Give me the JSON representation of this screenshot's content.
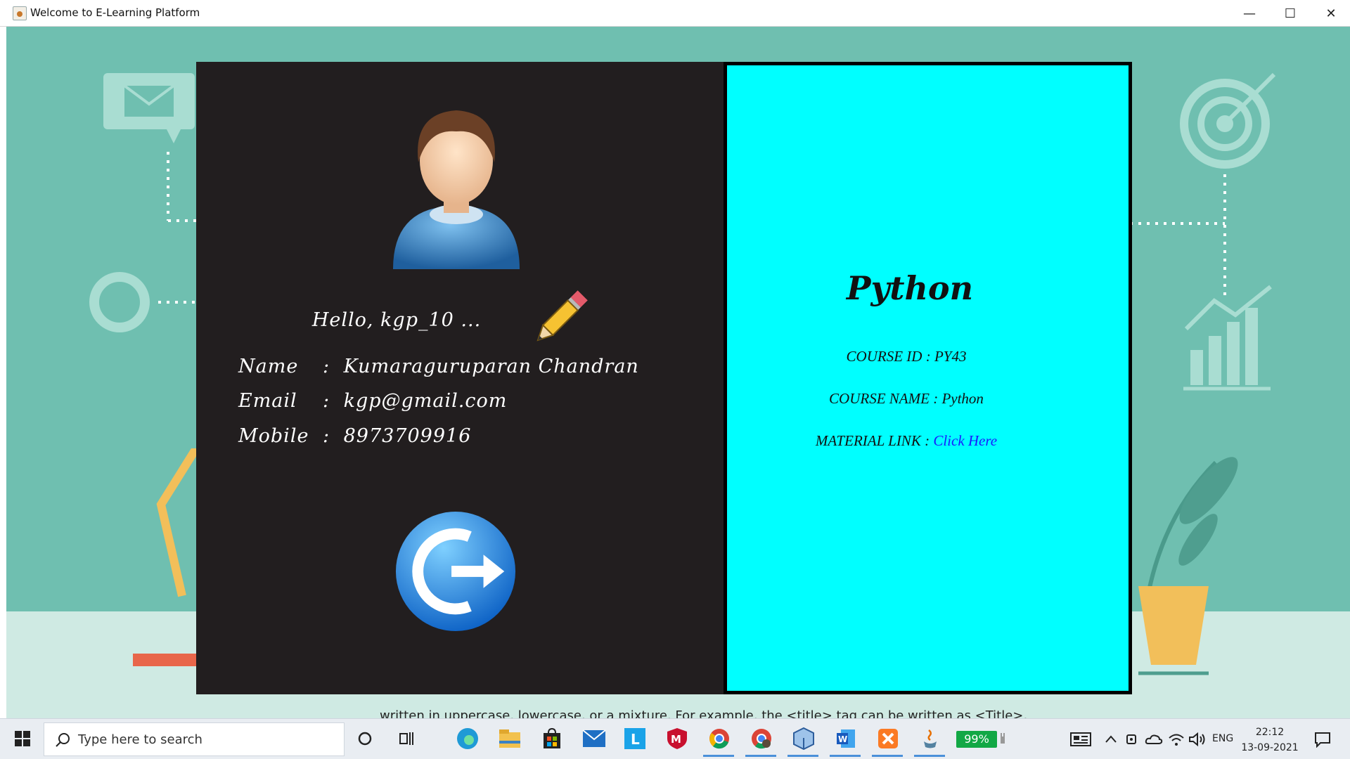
{
  "window": {
    "title": "Welcome to E-Learning Platform",
    "minimize_glyph": "—",
    "maximize_glyph": "☐",
    "close_glyph": "✕"
  },
  "profile": {
    "greeting": "Hello, kgp_10 ...",
    "name_label": "Name",
    "name_value": "Kumaraguruparan Chandran",
    "email_label": "Email",
    "email_value": "kgp@gmail.com",
    "mobile_label": "Mobile",
    "mobile_value": "8973709916",
    "separator": ":",
    "avatar_icon": "user-avatar-icon",
    "edit_icon": "pencil-icon",
    "logout_icon": "logout-icon"
  },
  "course": {
    "title": "Python",
    "id_label": "COURSE ID",
    "id_value": "PY43",
    "name_label": "COURSE NAME",
    "name_value": "Python",
    "material_label": "MATERIAL LINK",
    "material_link_text": "Click Here",
    "separator": ":"
  },
  "taskbar": {
    "search_placeholder": "Type here to search",
    "behind_text": "written in uppercase, lowercase, or a mixture. For example, the <title> tag can be written as <Title>,",
    "battery": "99%",
    "language": "ENG",
    "time": "22:12",
    "date": "13-09-2021"
  },
  "colors": {
    "background": "#6fbfb0",
    "left_panel": "#221e1f",
    "right_panel": "#00ffff",
    "link": "#1a1aff"
  }
}
